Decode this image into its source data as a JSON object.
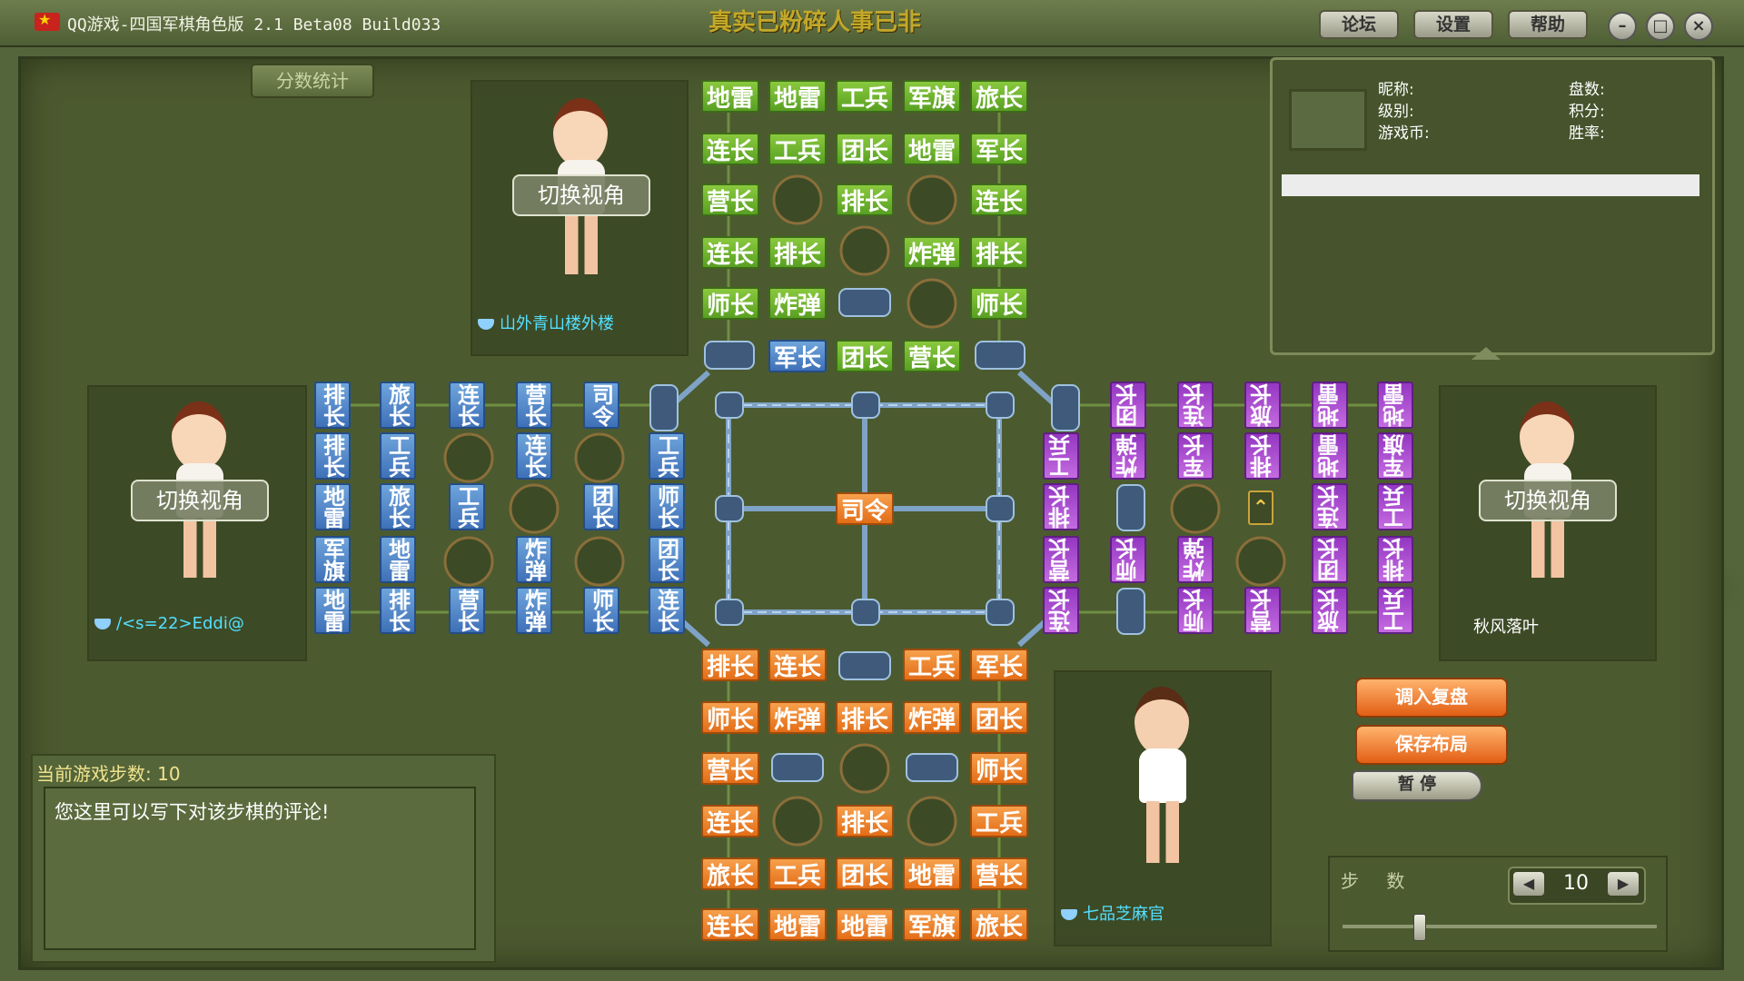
{
  "window": {
    "title": "QQ游戏-四国军棋角色版 2.1 Beta08 Build033",
    "marquee": "真实已粉碎人事已非",
    "buttons": [
      "论坛",
      "设置",
      "帮助"
    ],
    "window_controls": [
      "minimize-icon",
      "maximize-icon",
      "close-icon"
    ]
  },
  "score_button": "分数统计",
  "players": {
    "top": {
      "name": "山外青山楼外楼",
      "switch_label": "切换视角"
    },
    "left": {
      "name": "/<s=22>Eddi@",
      "switch_label": "切换视角"
    },
    "right": {
      "name": "秋风落叶",
      "switch_label": "切换视角"
    },
    "bottom": {
      "name": "七品芝麻官"
    }
  },
  "info_panel": {
    "nickname_label": "昵称:",
    "level_label": "级别:",
    "coins_label": "游戏币:",
    "games_label": "盘数:",
    "points_label": "积分:",
    "winrate_label": "胜率:"
  },
  "board": {
    "top_green": [
      "地雷",
      "地雷",
      "工兵",
      "军旗",
      "旅长",
      "连长",
      "工兵",
      "团长",
      "地雷",
      "军长",
      "营长",
      "排长",
      "连长",
      "连长",
      "排长",
      "炸弹",
      "排长",
      "师长",
      "炸弹",
      "师长"
    ],
    "top_blue_front": [
      "军长"
    ],
    "top_green_front": [
      "团长",
      "营长"
    ],
    "center": "司令",
    "bottom_orange": [
      "排长",
      "连长",
      "工兵",
      "军长",
      "师长",
      "炸弹",
      "排长",
      "炸弹",
      "团长",
      "营长",
      "师长",
      "连长",
      "排长",
      "工兵",
      "旅长",
      "工兵",
      "团长",
      "地雷",
      "营长",
      "连长",
      "地雷",
      "地雷",
      "军旗",
      "旅长"
    ],
    "left_blue": [
      "排长",
      "旅长",
      "连长",
      "营长",
      "司令",
      "排长",
      "工兵",
      "连长",
      "工兵",
      "地雷",
      "旅长",
      "工兵",
      "团长",
      "师长",
      "军旗",
      "地雷",
      "炸弹",
      "团长",
      "地雷",
      "排长",
      "营长",
      "炸弹",
      "师长",
      "连长"
    ],
    "right_purple": [
      "团长",
      "连长",
      "旅长",
      "地雷",
      "地雷",
      "工兵",
      "炸弹",
      "军长",
      "排长",
      "地雷",
      "军旗",
      "排长",
      "连长",
      "工兵",
      "营长",
      "师长",
      "炸弹",
      "团长",
      "排长",
      "连长",
      "师长",
      "营长",
      "旅长",
      "工兵"
    ]
  },
  "comment": {
    "step_header": "当前游戏步数: 10",
    "text": "您这里可以写下对该步棋的评论!"
  },
  "controls": {
    "load_replay": "调入复盘",
    "save_layout": "保存布局",
    "pause": "暂 停",
    "steps_label": "步 数",
    "step_value": "10"
  }
}
